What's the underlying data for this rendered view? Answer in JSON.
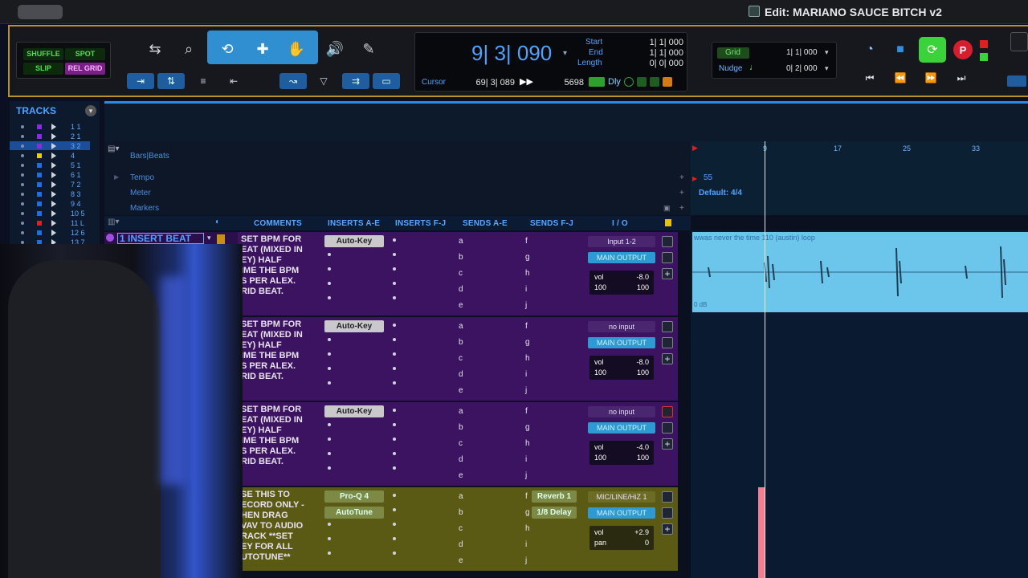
{
  "window": {
    "title": "Edit: MARIANO SAUCE BITCH v2"
  },
  "edit_modes": {
    "shuffle": "SHUFFLE",
    "spot": "SPOT",
    "slip": "SLIP",
    "grid": "REL GRID"
  },
  "counter": {
    "main": "9| 3| 090",
    "start_label": "Start",
    "start": "1| 1| 000",
    "end_label": "End",
    "end": "1| 1| 000",
    "length_label": "Length",
    "length": "0| 0| 000",
    "cursor_label": "Cursor",
    "cursor": "69| 3| 089",
    "cursor_value": "5698",
    "dly_label": "Dly"
  },
  "grid": {
    "grid_label": "Grid",
    "grid_value": "1| 1| 000",
    "nudge_label": "Nudge",
    "nudge_value": "0| 2| 000"
  },
  "tracks_panel": {
    "title": "TRACKS",
    "items": [
      {
        "label": "1 1",
        "color": "#8a2be2"
      },
      {
        "label": "2 1",
        "color": "#8a2be2"
      },
      {
        "label": "3 2",
        "color": "#8a2be2"
      },
      {
        "label": "4",
        "color": "#e6d200"
      },
      {
        "label": "5 1",
        "color": "#1e6fe0"
      },
      {
        "label": "6 1",
        "color": "#1e6fe0"
      },
      {
        "label": "7 2",
        "color": "#1e6fe0"
      },
      {
        "label": "8 3",
        "color": "#1e6fe0"
      },
      {
        "label": "9 4",
        "color": "#1e6fe0"
      },
      {
        "label": "10 5",
        "color": "#1e6fe0"
      },
      {
        "label": "11 L",
        "color": "#e02020"
      },
      {
        "label": "12 6",
        "color": "#1e6fe0"
      },
      {
        "label": "13 7",
        "color": "#1e6fe0"
      }
    ]
  },
  "rulers": {
    "bars_beats": "Bars|Beats",
    "tempo": "Tempo",
    "meter": "Meter",
    "markers": "Markers",
    "tempo_value": "55",
    "meter_value": "Default: 4/4",
    "bar_marks": [
      "9",
      "17",
      "25",
      "33"
    ]
  },
  "columns": {
    "comments": "COMMENTS",
    "inserts_ae": "INSERTS A-E",
    "inserts_fj": "INSERTS F-J",
    "sends_ae": "SENDS A-E",
    "sends_fj": "SENDS F-J",
    "io": "I / O"
  },
  "track_name": "1 INSERT BEAT",
  "send_letters_ae": [
    "a",
    "b",
    "c",
    "d",
    "e"
  ],
  "send_letters_fj": [
    "f",
    "g",
    "h",
    "i",
    "j"
  ],
  "tracks": [
    {
      "comment": "SET BPM FOR\nEAT (MIXED IN\nEY) HALF\nIME THE BPM\nS PER ALEX.\nRID BEAT.",
      "insert": "Auto-Key",
      "input": "Input 1-2",
      "output": "MAIN OUTPUT",
      "vol": "-8.0",
      "pan_l": "100",
      "pan_r": "100"
    },
    {
      "comment": "SET BPM FOR\nEAT (MIXED IN\nEY) HALF\nIME THE BPM\nS PER ALEX.\nRID BEAT.",
      "insert": "Auto-Key",
      "input": "no input",
      "output": "MAIN OUTPUT",
      "vol": "-8.0",
      "pan_l": "100",
      "pan_r": "100"
    },
    {
      "comment": "SET BPM FOR\nEAT (MIXED IN\nEY) HALF\nIME THE BPM\nS PER ALEX.\nRID BEAT.",
      "insert": "Auto-Key",
      "input": "no input",
      "output": "MAIN OUTPUT",
      "vol": "-4.0",
      "pan_l": "100",
      "pan_r": "100"
    },
    {
      "comment": "SE THIS TO\nECORD ONLY -\nHEN DRAG\nVAV TO AUDIO\nRACK **SET\nEY FOR ALL\nUTOTUNE**",
      "insert": "Pro-Q 4",
      "insert2": "AutoTune",
      "send_f": "Reverb 1",
      "send_g": "1/8 Delay",
      "input": "MIC/LINE/HiZ 1",
      "output": "MAIN OUTPUT",
      "vol": "+2.9",
      "pan_label": "pan",
      "pan": "0"
    }
  ],
  "clip": {
    "name": "wwas never the time 110 (austin) loop",
    "gain": "0 dB"
  },
  "colors": {
    "toolbar_border": "#b9932a",
    "accent": "#2f8fd0",
    "track_purple": "#3b1361",
    "track_olive": "#5a5a14",
    "clip": "#6cc6ec"
  }
}
